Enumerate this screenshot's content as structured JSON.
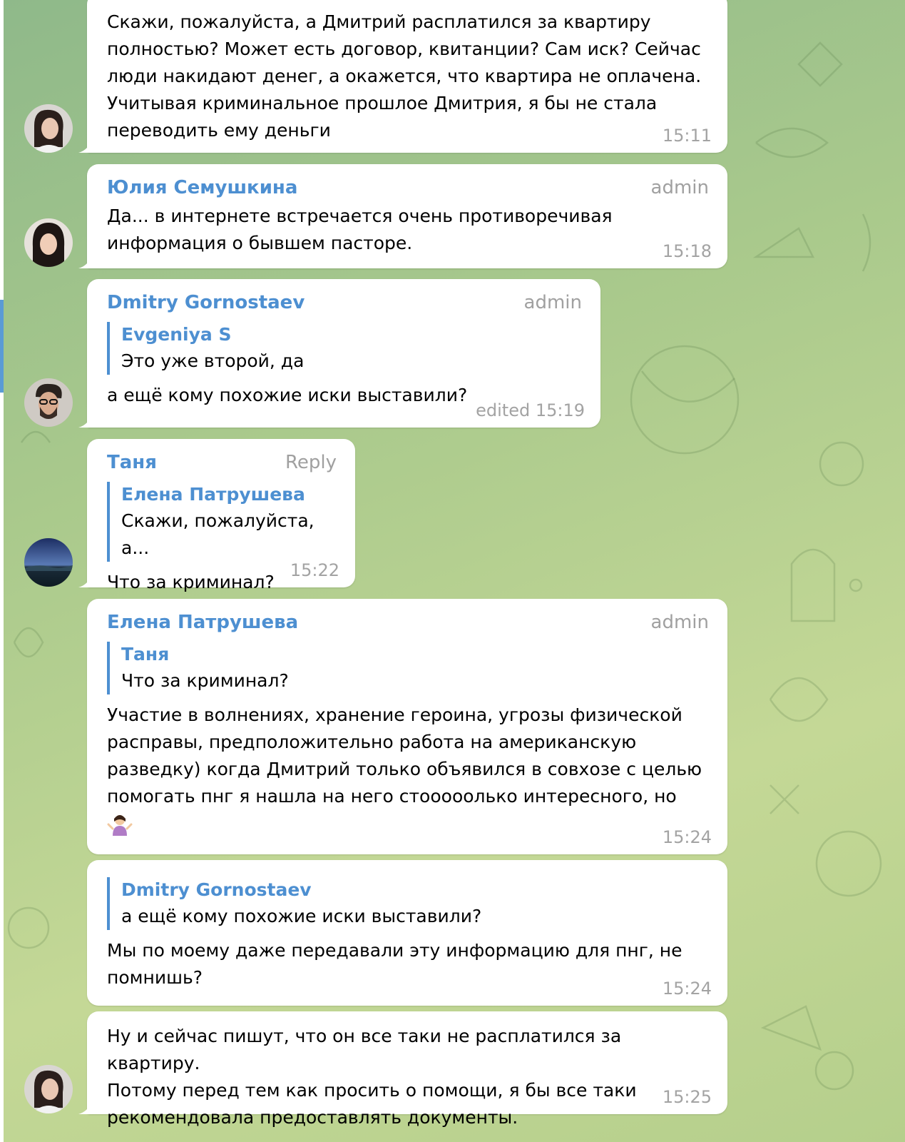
{
  "colors": {
    "accent": "#4d8fd1",
    "meta": "#a3a3a3",
    "bubble": "#ffffff"
  },
  "messages": [
    {
      "id": "m1",
      "text": "Скажи, пожалуйста, а Дмитрий расплатился за квартиру\nполностью? Может есть договор, квитанции? Сам иск? Сейчас\nлюди накидают денег, а окажется, что квартира не оплачена.\nУчитывая криминальное прошлое Дмитрия, я бы не стала\nпереводить ему деньги",
      "time": "15:11"
    },
    {
      "id": "m2",
      "sender": "Юлия Семушкина",
      "badge": "admin",
      "text": "Да... в интернете встречается очень противоречивая\nинформация о бывшем пасторе.",
      "time": "15:18"
    },
    {
      "id": "m3",
      "sender": "Dmitry Gornostaev",
      "badge": "admin",
      "quote": {
        "name": "Evgeniya S",
        "text": "Это уже второй, да"
      },
      "text": "а ещё кому похожие иски выставили?",
      "time": "edited 15:19"
    },
    {
      "id": "m4",
      "sender": "Таня",
      "badge": "Reply",
      "quote": {
        "name": "Елена Патрушева",
        "text": "Скажи, пожалуйста, а..."
      },
      "text": "Что за криминал?",
      "time": "15:22"
    },
    {
      "id": "m5",
      "sender": "Елена Патрушева",
      "badge": "admin",
      "quote": {
        "name": "Таня",
        "text": "Что за криминал?"
      },
      "text": "Участие в волнениях, хранение героина, угрозы физической\nрасправы, предположительно работа на американскую\nразведку) когда Дмитрий только объявился в совхозе с целью\nпомогать пнг я нашла на него стооооолько интересного, но",
      "time": "15:24"
    },
    {
      "id": "m6",
      "quote": {
        "name": "Dmitry Gornostaev",
        "text": "а ещё кому похожие иски выставили?"
      },
      "text": "Мы по моему даже передавали эту информацию для пнг, не\nпомнишь?",
      "time": "15:24"
    },
    {
      "id": "m7",
      "text": "Ну и сейчас пишут, что он все таки не расплатился за квартиру.\nПотому перед тем как просить о помощи, я бы все таки\nрекомендовала предоставлять документы.",
      "time": "15:25"
    }
  ]
}
